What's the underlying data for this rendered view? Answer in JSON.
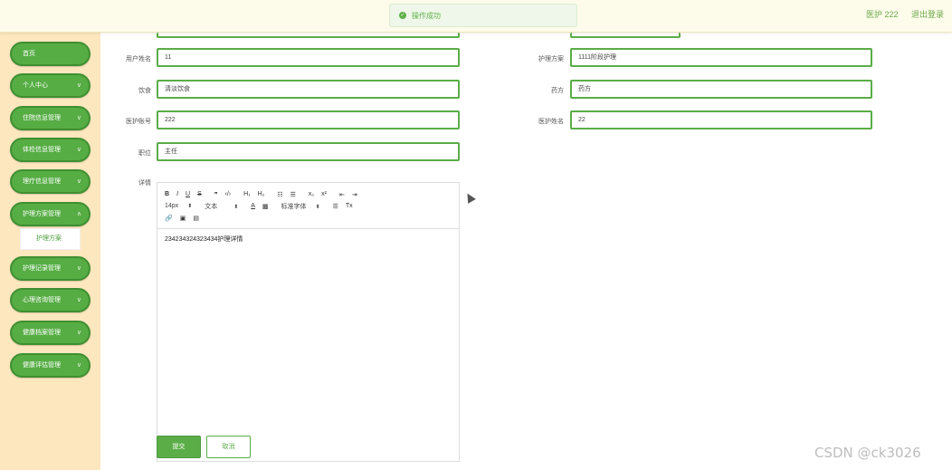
{
  "header": {
    "toast": "操作成功",
    "user": "医护 222",
    "logout": "退出登录"
  },
  "sidebar": {
    "items": [
      {
        "label": "首页"
      },
      {
        "label": "个人中心"
      },
      {
        "label": "住院信息管理"
      },
      {
        "label": "体检信息管理"
      },
      {
        "label": "理疗信息管理"
      },
      {
        "label": "护理方案管理"
      },
      {
        "label": "护理记录管理"
      },
      {
        "label": "心理咨询管理"
      },
      {
        "label": "健康档案管理"
      },
      {
        "label": "健康评估管理"
      }
    ],
    "submenu": "护理方案"
  },
  "form": {
    "user_name_label": "用户姓名",
    "user_name": "11",
    "plan_label": "护理方案",
    "plan": "1111阶段护理",
    "diet_label": "饮食",
    "diet": "清淡饮食",
    "medicine_label": "药方",
    "medicine": "药方",
    "staff_account_label": "医护账号",
    "staff_account": "222",
    "staff_name_label": "医护姓名",
    "staff_name": "22",
    "position_label": "职位",
    "position": "主任",
    "detail_label": "详情"
  },
  "editor": {
    "font_size": "14px",
    "format": "文本",
    "font_family": "标准字体",
    "content": "234234324323434护理详情"
  },
  "actions": {
    "submit": "提交",
    "cancel": "取消"
  },
  "watermark": "CSDN @ck3026"
}
